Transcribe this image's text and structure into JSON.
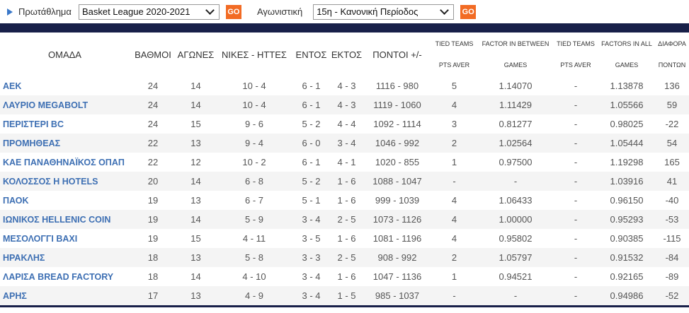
{
  "filters": {
    "championship_label": "Πρωτάθλημα",
    "championship_value": "Basket League 2020-2021",
    "round_label": "Αγωνιστική",
    "round_value": "15η - Κανονική Περίοδος",
    "go_label": "GO"
  },
  "table": {
    "headers": {
      "team": "ΟΜΑΔΑ",
      "points": "ΒΑΘΜΟΙ",
      "games": "ΑΓΩΝΕΣ",
      "wl": "ΝΙΚΕΣ - ΗΤΤΕΣ",
      "home": "ΕΝΤΟΣ",
      "away": "ΕΚΤΟΣ",
      "pf": "ΠΟΝΤΟΙ +/-",
      "tied1_line1": "TIED TEAMS",
      "tied1_line2": "PTS AVER",
      "factor1_line1": "FACTOR IN BETWEEN",
      "factor1_line2": "GAMES",
      "tied2_line1": "TIED TEAMS",
      "tied2_line2": "PTS AVER",
      "factor2_line1": "FACTORS IN ALL",
      "factor2_line2": "GAMES",
      "diff_line1": "ΔΙΑΦΟΡΑ",
      "diff_line2": "ΠΟΝΤΩΝ"
    },
    "rows": [
      {
        "team": "ΑΕΚ",
        "points": "24",
        "games": "14",
        "wl": "10 - 4",
        "home": "6 - 1",
        "away": "4 - 3",
        "pf": "1116 - 980",
        "tied1": "5",
        "factor1": "1.14070",
        "tied2": "-",
        "factor2": "1.13878",
        "diff": "136"
      },
      {
        "team": "ΛΑΥΡΙΟ MEGABOLT",
        "points": "24",
        "games": "14",
        "wl": "10 - 4",
        "home": "6 - 1",
        "away": "4 - 3",
        "pf": "1119 - 1060",
        "tied1": "4",
        "factor1": "1.11429",
        "tied2": "-",
        "factor2": "1.05566",
        "diff": "59"
      },
      {
        "team": "ΠΕΡΙΣΤΕΡΙ BC",
        "points": "24",
        "games": "15",
        "wl": "9 - 6",
        "home": "5 - 2",
        "away": "4 - 4",
        "pf": "1092 - 1114",
        "tied1": "3",
        "factor1": "0.81277",
        "tied2": "-",
        "factor2": "0.98025",
        "diff": "-22"
      },
      {
        "team": "ΠΡΟΜΗΘΕΑΣ",
        "points": "22",
        "games": "13",
        "wl": "9 - 4",
        "home": "6 - 0",
        "away": "3 - 4",
        "pf": "1046 - 992",
        "tied1": "2",
        "factor1": "1.02564",
        "tied2": "-",
        "factor2": "1.05444",
        "diff": "54"
      },
      {
        "team": "ΚΑΕ ΠΑΝΑΘΗΝΑΪΚΟΣ ΟΠΑΠ",
        "points": "22",
        "games": "12",
        "wl": "10 - 2",
        "home": "6 - 1",
        "away": "4 - 1",
        "pf": "1020 - 855",
        "tied1": "1",
        "factor1": "0.97500",
        "tied2": "-",
        "factor2": "1.19298",
        "diff": "165"
      },
      {
        "team": "ΚΟΛΟΣΣΟΣ H HOTELS",
        "points": "20",
        "games": "14",
        "wl": "6 - 8",
        "home": "5 - 2",
        "away": "1 - 6",
        "pf": "1088 - 1047",
        "tied1": "-",
        "factor1": "-",
        "tied2": "-",
        "factor2": "1.03916",
        "diff": "41"
      },
      {
        "team": "ΠΑΟΚ",
        "points": "19",
        "games": "13",
        "wl": "6 - 7",
        "home": "5 - 1",
        "away": "1 - 6",
        "pf": "999 - 1039",
        "tied1": "4",
        "factor1": "1.06433",
        "tied2": "-",
        "factor2": "0.96150",
        "diff": "-40"
      },
      {
        "team": "ΙΩΝΙΚΟΣ HELLENIC COIN",
        "points": "19",
        "games": "14",
        "wl": "5 - 9",
        "home": "3 - 4",
        "away": "2 - 5",
        "pf": "1073 - 1126",
        "tied1": "4",
        "factor1": "1.00000",
        "tied2": "-",
        "factor2": "0.95293",
        "diff": "-53"
      },
      {
        "team": "ΜΕΣΟΛΟΓΓΙ ΒΑΧΙ",
        "points": "19",
        "games": "15",
        "wl": "4 - 11",
        "home": "3 - 5",
        "away": "1 - 6",
        "pf": "1081 - 1196",
        "tied1": "4",
        "factor1": "0.95802",
        "tied2": "-",
        "factor2": "0.90385",
        "diff": "-115"
      },
      {
        "team": "ΗΡΑΚΛΗΣ",
        "points": "18",
        "games": "13",
        "wl": "5 - 8",
        "home": "3 - 3",
        "away": "2 - 5",
        "pf": "908 - 992",
        "tied1": "2",
        "factor1": "1.05797",
        "tied2": "-",
        "factor2": "0.91532",
        "diff": "-84"
      },
      {
        "team": "ΛΑΡΙΣΑ BREAD FACTORY",
        "points": "18",
        "games": "14",
        "wl": "4 - 10",
        "home": "3 - 4",
        "away": "1 - 6",
        "pf": "1047 - 1136",
        "tied1": "1",
        "factor1": "0.94521",
        "tied2": "-",
        "factor2": "0.92165",
        "diff": "-89"
      },
      {
        "team": "ΑΡΗΣ",
        "points": "17",
        "games": "13",
        "wl": "4 - 9",
        "home": "3 - 4",
        "away": "1 - 5",
        "pf": "985 - 1037",
        "tied1": "-",
        "factor1": "-",
        "tied2": "-",
        "factor2": "0.94986",
        "diff": "-52"
      }
    ]
  },
  "colors": {
    "accent": "#f26b24",
    "navy": "#182049",
    "team_link": "#3d6fb3"
  }
}
